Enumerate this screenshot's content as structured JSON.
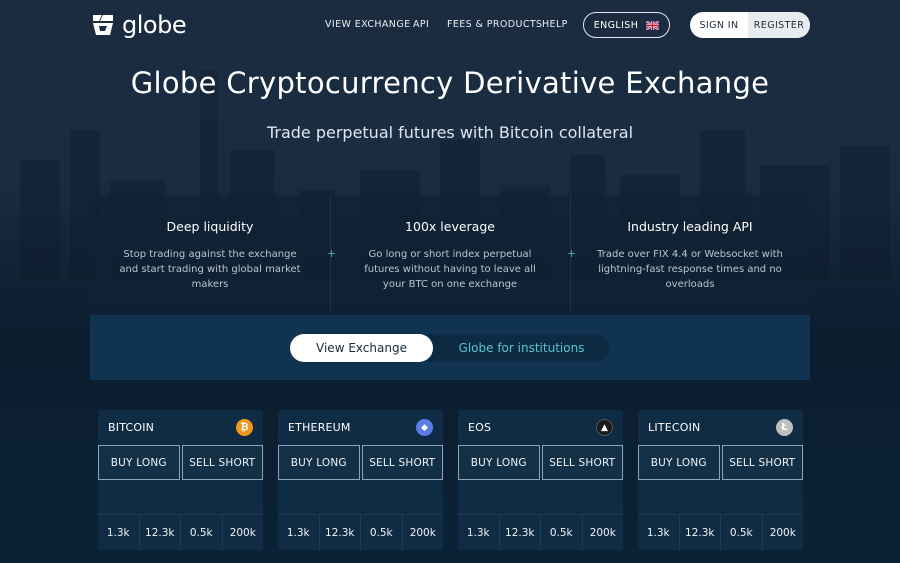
{
  "brand": {
    "name": "globe"
  },
  "nav": {
    "links": [
      "VIEW EXCHANGE",
      "API",
      "FEES & PRODUCTS",
      "HELP"
    ],
    "language": "ENGLISH",
    "sign_in": "SIGN IN",
    "register": "REGISTER"
  },
  "hero": {
    "title": "Globe Cryptocurrency Derivative Exchange",
    "subtitle": "Trade perpetual futures with Bitcoin collateral"
  },
  "features": [
    {
      "title": "Deep liquidity",
      "text": "Stop trading against the exchange and start trading with global market makers"
    },
    {
      "title": "100x leverage",
      "text": "Go long or short index perpetual futures without having to leave all your BTC on one exchange"
    },
    {
      "title": "Industry leading API",
      "text": "Trade over FIX 4.4 or Websocket with lightning-fast response times and no overloads"
    }
  ],
  "feature_separator": "+",
  "cta": {
    "view_exchange": "View Exchange",
    "institutions": "Globe for institutions"
  },
  "markets": [
    {
      "name": "BITCOIN",
      "icon": "bitcoin-icon",
      "color": "#f2961d",
      "symbol": "₿",
      "buy": "BUY LONG",
      "sell": "SELL SHORT",
      "stats": [
        "1.3k",
        "12.3k",
        "0.5k",
        "200k"
      ]
    },
    {
      "name": "ETHEREUM",
      "icon": "ethereum-icon",
      "color": "#5c7de8",
      "symbol": "◆",
      "buy": "BUY LONG",
      "sell": "SELL SHORT",
      "stats": [
        "1.3k",
        "12.3k",
        "0.5k",
        "200k"
      ]
    },
    {
      "name": "EOS",
      "icon": "eos-icon",
      "color": "#1b1b1b",
      "symbol": "▲",
      "buy": "BUY LONG",
      "sell": "SELL SHORT",
      "stats": [
        "1.3k",
        "12.3k",
        "0.5k",
        "200k"
      ]
    },
    {
      "name": "LITECOIN",
      "icon": "litecoin-icon",
      "color": "#bfbfbf",
      "symbol": "Ł",
      "buy": "BUY LONG",
      "sell": "SELL SHORT",
      "stats": [
        "1.3k",
        "12.3k",
        "0.5k",
        "200k"
      ]
    }
  ]
}
